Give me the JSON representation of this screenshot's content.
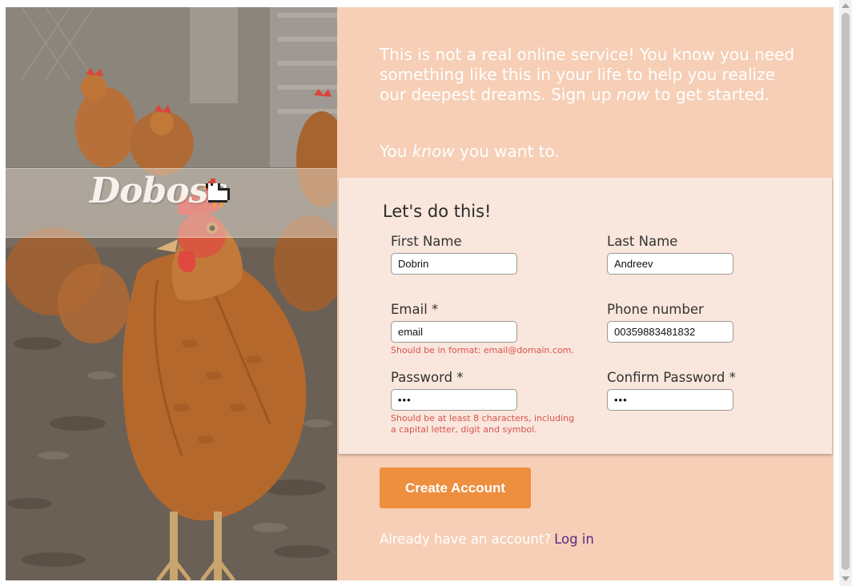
{
  "brand": {
    "name": "Doboss",
    "logo_icon": "chicken-pixel-icon"
  },
  "intro": {
    "part1": "This is not a real online service! You know you need something like this in your life to help you realize our deepest dreams. Sign up ",
    "emphasis": "now",
    "part2": " to get started.",
    "tagline_before": "You ",
    "tagline_emphasis": "know",
    "tagline_after": " you want to."
  },
  "form": {
    "title": "Let's do this!",
    "first_name": {
      "label": "First Name",
      "value": "Dobrin"
    },
    "last_name": {
      "label": "Last Name",
      "value": "Andreev"
    },
    "email": {
      "label": "Email *",
      "value": "email",
      "error": "Should be in format: email@domain.com."
    },
    "phone": {
      "label": "Phone number",
      "value": "00359883481832"
    },
    "password": {
      "label": "Password *",
      "value": "•••",
      "error": "Should be at least 8 characters, including a capital letter, digit and symbol."
    },
    "confirm_password": {
      "label": "Confirm Password *",
      "value": "•••"
    }
  },
  "actions": {
    "create_account": "Create Account",
    "login_prompt": "Already have an account?",
    "login_link": "Log in"
  },
  "colors": {
    "panel_background": "#f6cfb6",
    "form_background": "#f9e6dc",
    "button": "#ee8e3f",
    "error": "#d9534f",
    "link": "#5b2a86"
  }
}
